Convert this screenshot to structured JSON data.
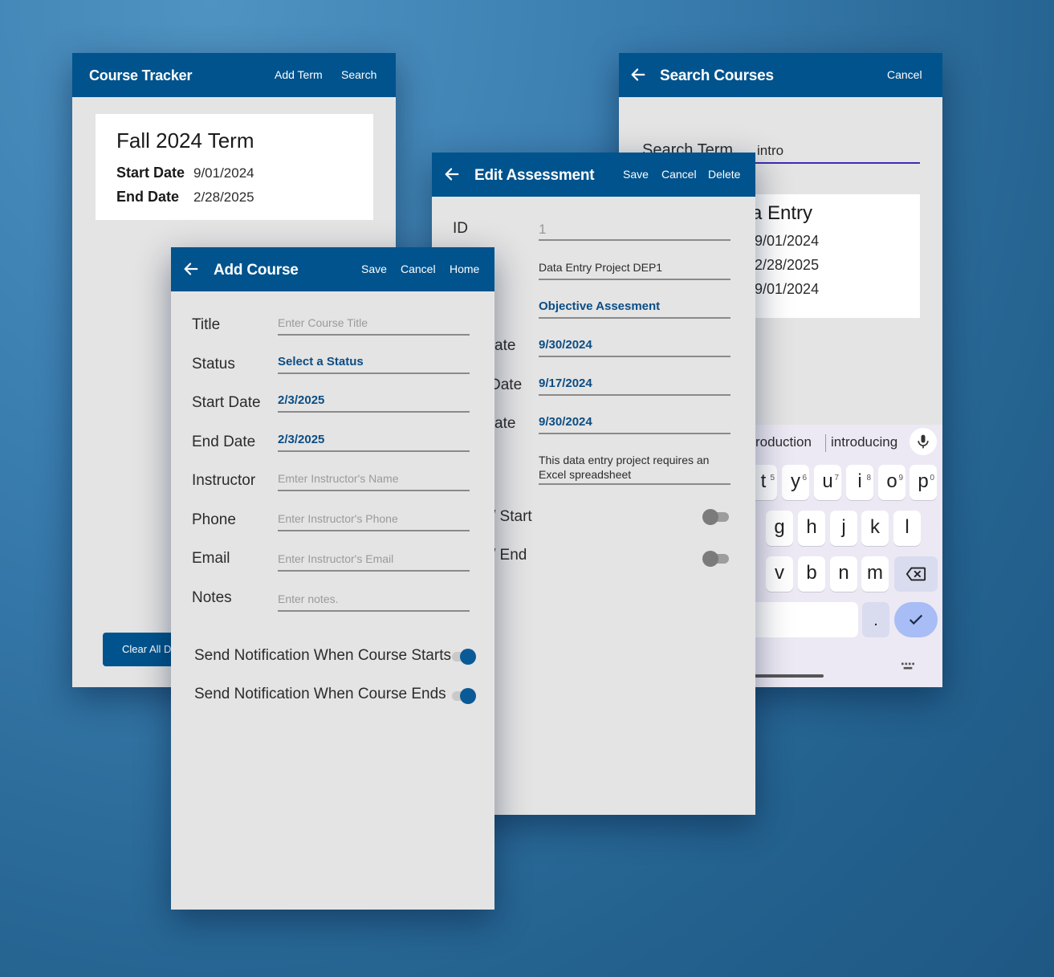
{
  "colors": {
    "brand": "#00538d",
    "accent": "#0b5a98",
    "screen_bg": "#e4e4e4"
  },
  "course_tracker": {
    "title": "Course Tracker",
    "actions": [
      "Add Term",
      "Search"
    ],
    "term": {
      "name": "Fall 2024 Term",
      "start_label": "Start Date",
      "start": "9/01/2024",
      "end_label": "End Date",
      "end": "2/28/2025"
    },
    "clear_button": "Clear All D"
  },
  "search_courses": {
    "title": "Search Courses",
    "cancel": "Cancel",
    "search_label": "Search Term",
    "search_value": "intro",
    "result": {
      "name": "a Entry",
      "lines": [
        "9/01/2024",
        "2/28/2025",
        "9/01/2024"
      ]
    },
    "keyboard": {
      "suggestions": [
        "roduction",
        "introducing"
      ],
      "row1": [
        "t",
        "y",
        "u",
        "i",
        "o",
        "p"
      ],
      "row1_nums": [
        "5",
        "6",
        "7",
        "8",
        "9",
        "0"
      ],
      "row2": [
        "g",
        "h",
        "j",
        "k",
        "l"
      ],
      "row3": [
        "v",
        "b",
        "n",
        "m"
      ],
      "period": ".",
      "icons": [
        "microphone-icon",
        "backspace-icon",
        "check-icon",
        "keyboard-icon"
      ]
    }
  },
  "edit_assessment": {
    "title": "Edit Assessment",
    "actions": [
      "Save",
      "Cancel",
      "Delete"
    ],
    "id_label": "ID",
    "id_value": "1",
    "name_value": "Data Entry Project DEP1",
    "type_value": "Objective Assesment",
    "due_label": "ate",
    "due_value": "9/30/2024",
    "start_label": "Date",
    "start_value": "9/17/2024",
    "end_label": "ate",
    "end_value": "9/30/2024",
    "notes": "This data entry project requires an Excel spreadsheet",
    "notify_start_label": "/ Start",
    "notify_end_label": "/ End"
  },
  "add_course": {
    "title": "Add Course",
    "actions": [
      "Save",
      "Cancel",
      "Home"
    ],
    "fields": {
      "title_label": "Title",
      "title_placeholder": "Enter Course Title",
      "status_label": "Status",
      "status_value": "Select a Status",
      "start_label": "Start Date",
      "start_value": "2/3/2025",
      "end_label": "End Date",
      "end_value": "2/3/2025",
      "instructor_label": "Instructor",
      "instructor_placeholder": "Emter Instructor's Name",
      "phone_label": "Phone",
      "phone_placeholder": "Enter Instructor's Phone",
      "email_label": "Email",
      "email_placeholder": "Enter Instructor's Email",
      "notes_label": "Notes",
      "notes_placeholder": "Enter notes."
    },
    "notify_start": "Send Notification When Course Starts",
    "notify_end": "Send Notification When Course Ends"
  }
}
